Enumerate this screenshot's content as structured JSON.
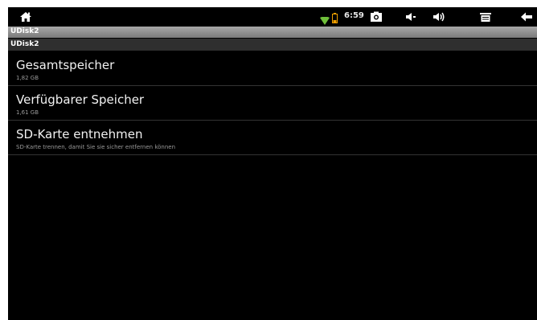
{
  "status_bar": {
    "time": "6:59",
    "icons": [
      "home-icon",
      "wifi-icon",
      "battery-icon",
      "screenshot-icon",
      "volume-down-icon",
      "volume-up-icon",
      "menu-icon",
      "back-icon"
    ],
    "wifi_color": "#6fbf3a",
    "battery_color": "#f0a000"
  },
  "title_bar": {
    "title": "UDisk2"
  },
  "section": {
    "header": "UDisk2"
  },
  "preferences": [
    {
      "title": "Gesamtspeicher",
      "summary": "1,82 GB"
    },
    {
      "title": "Verfügbarer Speicher",
      "summary": "1,61 GB"
    },
    {
      "title": "SD-Karte entnehmen",
      "summary": "SD-Karte trennen, damit Sie sie sicher entfernen können"
    }
  ]
}
